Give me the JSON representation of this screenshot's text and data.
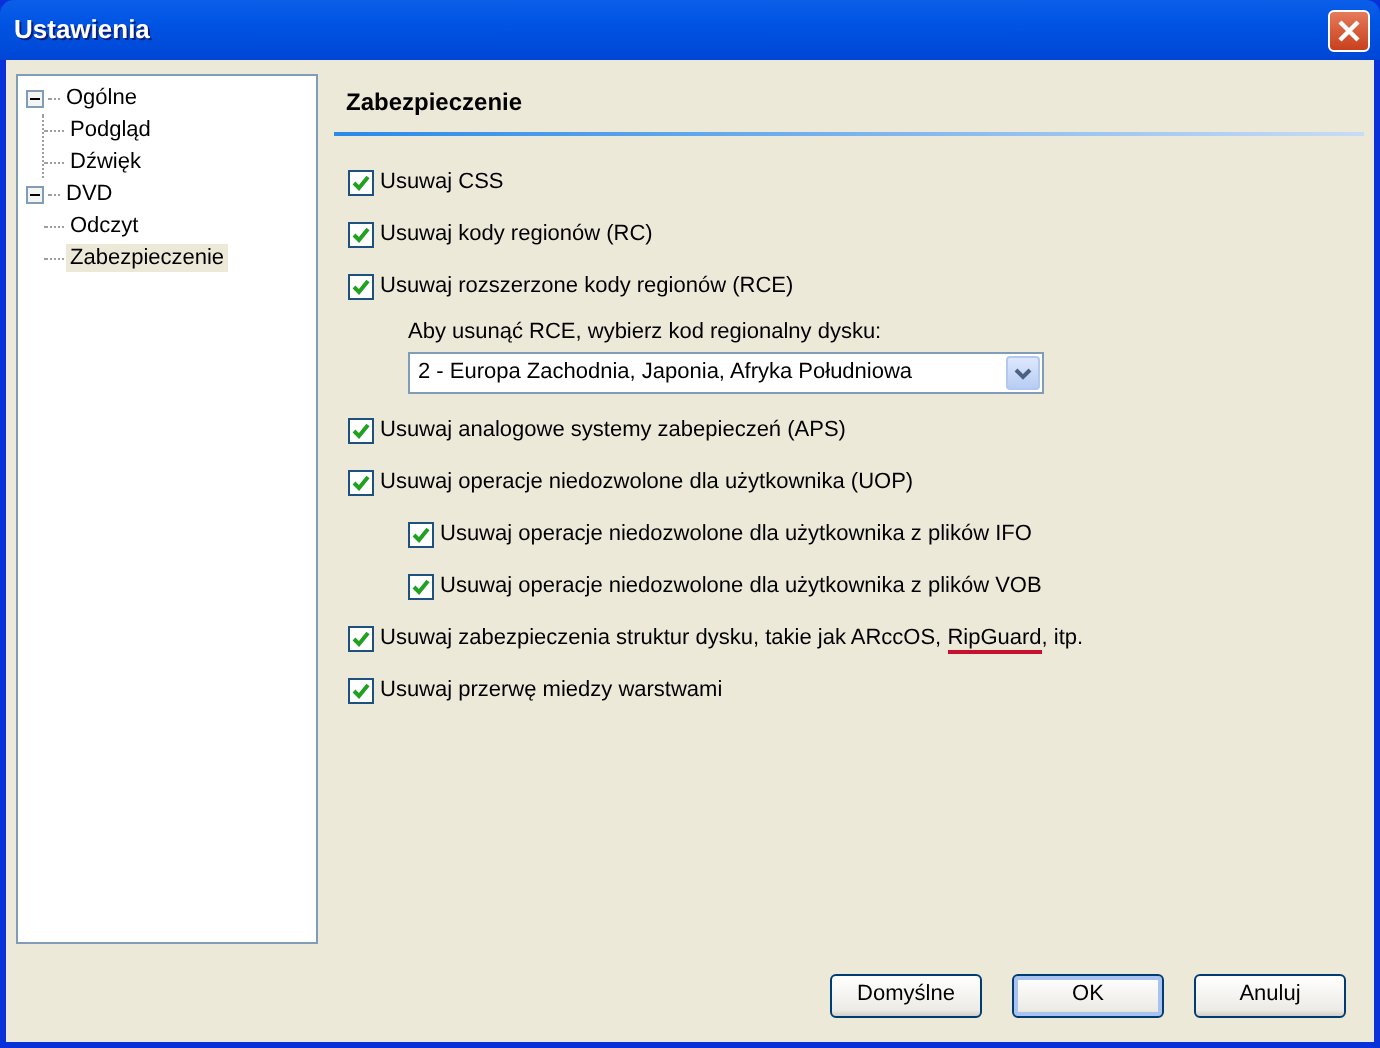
{
  "window": {
    "title": "Ustawienia"
  },
  "tree": [
    {
      "label": "Ogólne",
      "expanded": true,
      "selected": false,
      "children": [
        {
          "label": "Podgląd",
          "selected": false
        },
        {
          "label": "Dźwięk",
          "selected": false
        }
      ]
    },
    {
      "label": "DVD",
      "expanded": true,
      "selected": false,
      "children": [
        {
          "label": "Odczyt",
          "selected": false
        },
        {
          "label": "Zabezpieczenie",
          "selected": true
        }
      ]
    }
  ],
  "section_title": "Zabezpieczenie",
  "options": [
    {
      "kind": "checkbox",
      "indent": false,
      "checked": true,
      "parts": [
        {
          "text": "Usuwaj CSS",
          "underlined": false
        }
      ]
    },
    {
      "kind": "checkbox",
      "indent": false,
      "checked": true,
      "parts": [
        {
          "text": "Usuwaj kody regionów (RC)",
          "underlined": false
        }
      ]
    },
    {
      "kind": "checkbox",
      "indent": false,
      "checked": true,
      "parts": [
        {
          "text": "Usuwaj rozszerzone kody regionów (RCE)",
          "underlined": false
        }
      ]
    },
    {
      "kind": "label",
      "text": "Aby usunąć RCE, wybierz kod regionalny dysku:"
    },
    {
      "kind": "dropdown",
      "value": "2 - Europa Zachodnia, Japonia, Afryka Południowa"
    },
    {
      "kind": "checkbox",
      "indent": false,
      "checked": true,
      "parts": [
        {
          "text": "Usuwaj analogowe systemy zabepieczeń (APS)",
          "underlined": false
        }
      ]
    },
    {
      "kind": "checkbox",
      "indent": false,
      "checked": true,
      "parts": [
        {
          "text": "Usuwaj operacje niedozwolone dla użytkownika (UOP)",
          "underlined": false
        }
      ]
    },
    {
      "kind": "checkbox",
      "indent": true,
      "checked": true,
      "parts": [
        {
          "text": "Usuwaj operacje niedozwolone dla użytkownika z plików IFO",
          "underlined": false
        }
      ]
    },
    {
      "kind": "checkbox",
      "indent": true,
      "checked": true,
      "parts": [
        {
          "text": "Usuwaj operacje niedozwolone dla użytkownika z plików VOB",
          "underlined": false
        }
      ]
    },
    {
      "kind": "checkbox",
      "indent": false,
      "checked": true,
      "parts": [
        {
          "text": "Usuwaj zabezpieczenia struktur dysku, takie jak ARccOS, ",
          "underlined": false
        },
        {
          "text": "RipGuard",
          "underlined": true
        },
        {
          "text": ", itp.",
          "underlined": false
        }
      ]
    },
    {
      "kind": "checkbox",
      "indent": false,
      "checked": true,
      "parts": [
        {
          "text": "Usuwaj przerwę miedzy warstwami",
          "underlined": false
        }
      ]
    }
  ],
  "buttons": [
    {
      "label": "Domyślne",
      "default": false
    },
    {
      "label": "OK",
      "default": true
    },
    {
      "label": "Anuluj",
      "default": false
    }
  ]
}
